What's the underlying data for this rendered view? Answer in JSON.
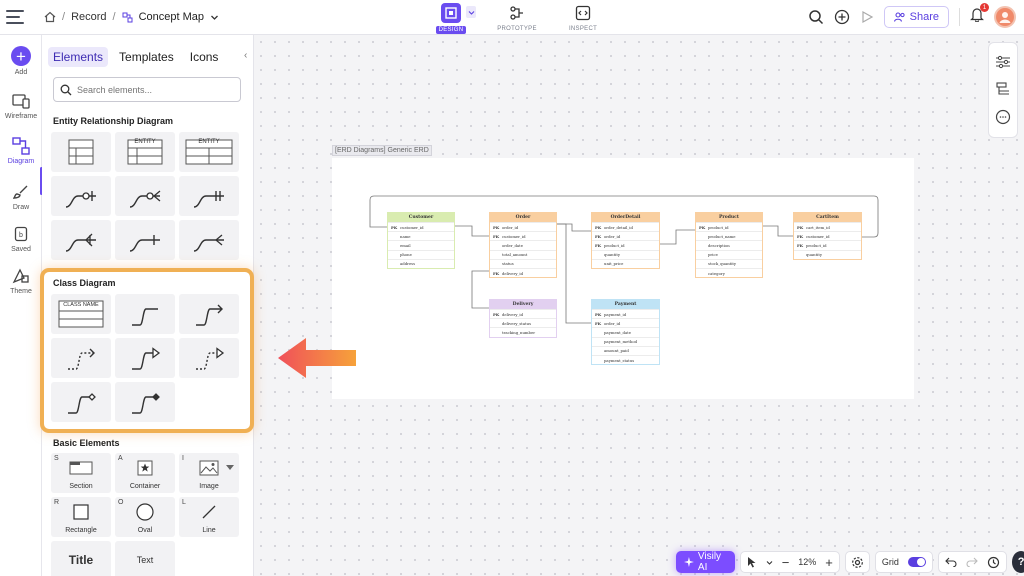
{
  "header": {
    "breadcrumb_root": "Record",
    "project_name": "Concept Map",
    "modes": [
      {
        "label": "DESIGN",
        "active": true
      },
      {
        "label": "PROTOTYPE",
        "active": false
      },
      {
        "label": "INSPECT",
        "active": false
      }
    ],
    "share_label": "Share",
    "notification_count": "1"
  },
  "rail": {
    "items": [
      {
        "label": "Add"
      },
      {
        "label": "Wireframe"
      },
      {
        "label": "Diagram"
      },
      {
        "label": "Draw"
      },
      {
        "label": "Saved"
      },
      {
        "label": "Theme"
      }
    ]
  },
  "panel": {
    "tabs": [
      "Elements",
      "Templates",
      "Icons"
    ],
    "search_placeholder": "Search elements...",
    "er_title": "Entity Relationship Diagram",
    "er_entity_label": "ENTITY",
    "class_title": "Class Diagram",
    "class_name_label": "CLASS NAME",
    "basic_title": "Basic Elements",
    "basic": [
      {
        "key": "S",
        "label": "Section"
      },
      {
        "key": "A",
        "label": "Container"
      },
      {
        "key": "I",
        "label": "Image"
      },
      {
        "key": "R",
        "label": "Rectangle"
      },
      {
        "key": "O",
        "label": "Oval"
      },
      {
        "key": "L",
        "label": "Line"
      },
      {
        "key": "",
        "label": "Title"
      },
      {
        "key": "",
        "label": "Text"
      }
    ]
  },
  "canvas": {
    "frame_label": "[ERD Diagrams] Generic ERD",
    "tables": [
      {
        "name": "Customer",
        "color": "#d9ecb0",
        "rows": [
          [
            "PK",
            "customer_id"
          ],
          [
            "",
            "name"
          ],
          [
            "",
            "email"
          ],
          [
            "",
            "phone"
          ],
          [
            "",
            "address"
          ]
        ]
      },
      {
        "name": "Order",
        "color": "#f9cfa0",
        "rows": [
          [
            "PK",
            "order_id"
          ],
          [
            "FK",
            "customer_id"
          ],
          [
            "",
            "order_date"
          ],
          [
            "",
            "total_amount"
          ],
          [
            "",
            "status"
          ],
          [
            "FK",
            "delivery_id"
          ]
        ]
      },
      {
        "name": "OrderDetail",
        "color": "#f9cfa0",
        "rows": [
          [
            "PK",
            "order_detail_id"
          ],
          [
            "FK",
            "order_id"
          ],
          [
            "FK",
            "product_id"
          ],
          [
            "",
            "quantity"
          ],
          [
            "",
            "unit_price"
          ]
        ]
      },
      {
        "name": "Product",
        "color": "#f9cfa0",
        "rows": [
          [
            "PK",
            "product_id"
          ],
          [
            "",
            "product_name"
          ],
          [
            "",
            "description"
          ],
          [
            "",
            "price"
          ],
          [
            "",
            "stock_quantity"
          ],
          [
            "",
            "category"
          ]
        ]
      },
      {
        "name": "CartItem",
        "color": "#f9cfa0",
        "rows": [
          [
            "PK",
            "cart_item_id"
          ],
          [
            "FK",
            "customer_id"
          ],
          [
            "FK",
            "product_id"
          ],
          [
            "",
            "quantity"
          ]
        ]
      },
      {
        "name": "Delivery",
        "color": "#e2d0f0",
        "rows": [
          [
            "PK",
            "delivery_id"
          ],
          [
            "",
            "delivery_status"
          ],
          [
            "",
            "tracking_number"
          ]
        ]
      },
      {
        "name": "Payment",
        "color": "#bfe3f5",
        "rows": [
          [
            "PK",
            "payment_id"
          ],
          [
            "FK",
            "order_id"
          ],
          [
            "",
            "payment_date"
          ],
          [
            "",
            "payment_method"
          ],
          [
            "",
            "amount_paid"
          ],
          [
            "",
            "payment_status"
          ]
        ]
      }
    ]
  },
  "bottom": {
    "visily_label": "Visily AI",
    "zoom": "12%",
    "grid_label": "Grid",
    "grid_on": true,
    "help": "?"
  },
  "colors": {
    "accent": "#6a4cf0",
    "highlight": "#f0b054"
  }
}
